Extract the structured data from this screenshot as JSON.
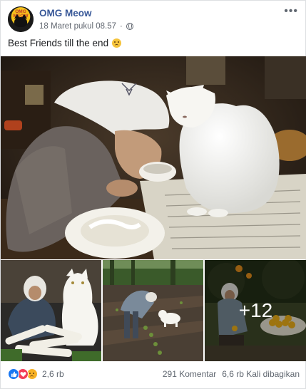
{
  "post": {
    "page_name": "OMG Meow",
    "avatar_text": "OMG MEOW",
    "timestamp": "18 Maret pukul 08.57",
    "privacy_icon": "globe-icon",
    "more_icon": "more-options-icon",
    "caption": "Best Friends till the end",
    "caption_emoji": "sad-face-emoji"
  },
  "photos": {
    "main": {
      "description": "elderly-woman-and-white-cat-at-table"
    },
    "thumbs": [
      {
        "description": "woman-and-cat-with-daikon-radishes"
      },
      {
        "description": "woman-and-cat-in-garden"
      },
      {
        "description": "woman-with-oranges",
        "overlay": "+12"
      }
    ]
  },
  "footer": {
    "reaction_icons": [
      "like-icon",
      "love-icon",
      "sad-icon"
    ],
    "reaction_count": "2,6 rb",
    "comments": "291 Komentar",
    "shares": "6,6 rb Kali dibagikan"
  },
  "colors": {
    "link": "#385898",
    "secondary_text": "#616770",
    "like_blue": "#1877f2",
    "love_red": "#f33e58",
    "sad_yellow": "#f7b125"
  }
}
